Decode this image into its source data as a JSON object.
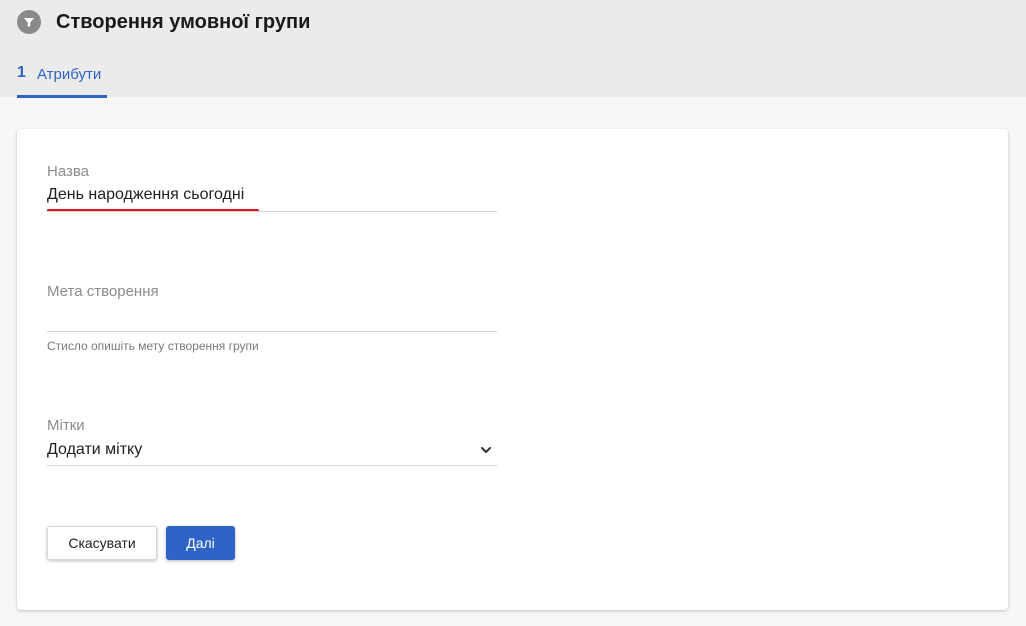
{
  "header": {
    "title": "Створення умовної групи",
    "icon": "filter-icon"
  },
  "tabs": [
    {
      "number": "1",
      "label": "Атрибути",
      "active": true
    }
  ],
  "form": {
    "name": {
      "label": "Назва",
      "value": "День народження сьогодні"
    },
    "purpose": {
      "label": "Мета створення",
      "value": "",
      "helper": "Стисло опишіть мету створення групи"
    },
    "tags": {
      "label": "Мітки",
      "value": "Додати мітку",
      "icon": "chevron-down-icon"
    }
  },
  "buttons": {
    "cancel_label": "Скасувати",
    "next_label": "Далі"
  },
  "colors": {
    "accent": "#2f63c6",
    "annotation": "#e0141a",
    "header_bg": "#ebebeb"
  }
}
